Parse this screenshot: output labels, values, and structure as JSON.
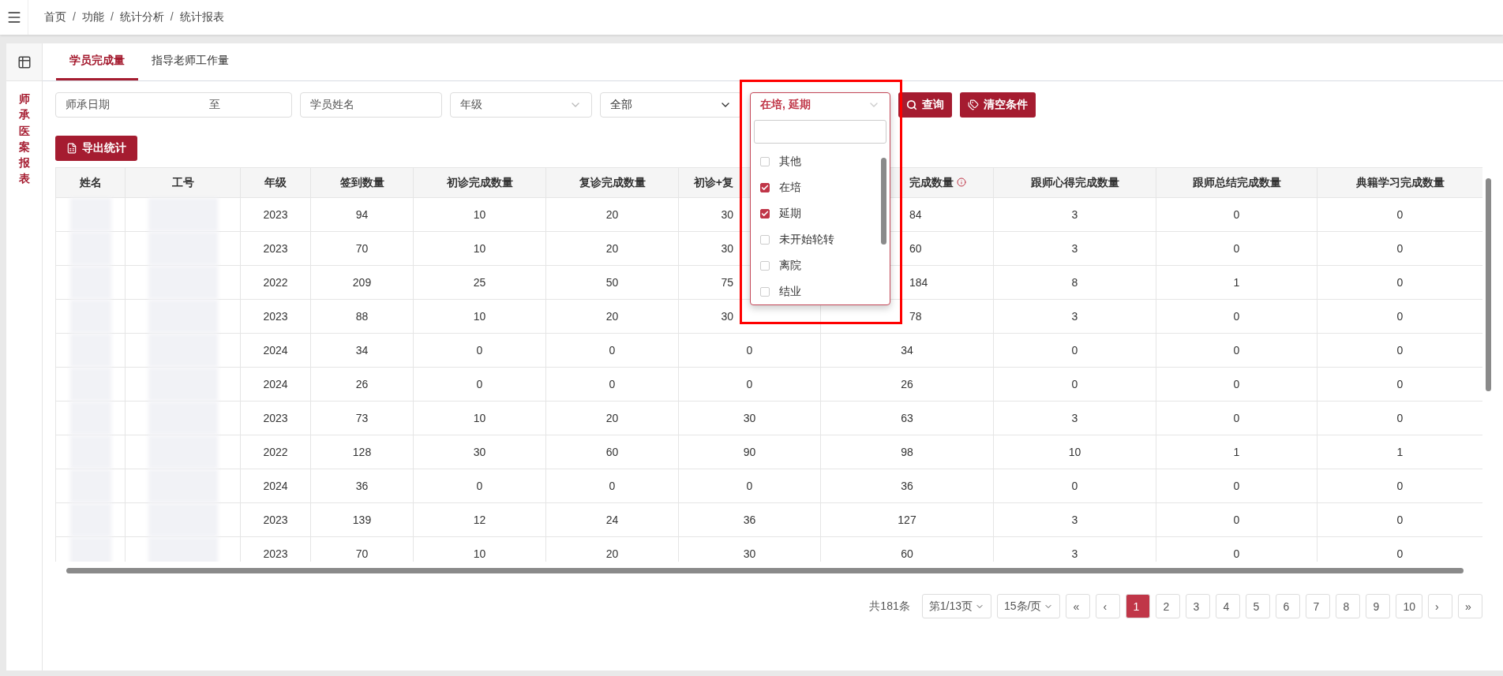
{
  "breadcrumb": {
    "separator": "/",
    "items": [
      "首页",
      "功能",
      "统计分析",
      "统计报表"
    ]
  },
  "side_label": "师承医案报表",
  "tabs": [
    {
      "label": "学员完成量",
      "selected": true
    },
    {
      "label": "指导老师工作量",
      "selected": false
    }
  ],
  "filters": {
    "date_range": {
      "placeholder": "师承日期",
      "separator": "至"
    },
    "name_field": {
      "placeholder": "学员姓名"
    },
    "grade_select": {
      "placeholder": "年级"
    },
    "type_select": {
      "value": "全部"
    },
    "status_select": {
      "value": "在培, 延期",
      "expanded": true,
      "options": [
        {
          "label": "其他",
          "checked": false
        },
        {
          "label": "在培",
          "checked": true
        },
        {
          "label": "延期",
          "checked": true
        },
        {
          "label": "未开始轮转",
          "checked": false
        },
        {
          "label": "离院",
          "checked": false
        },
        {
          "label": "结业",
          "checked": false
        }
      ]
    },
    "query_button": "查询",
    "clear_button": "清空条件"
  },
  "export_button": "导出统计",
  "table": {
    "columns": [
      "姓名",
      "工号",
      "年级",
      "签到数量",
      "初诊完成数量",
      "复诊完成数量",
      "初诊+复",
      "完成数量",
      "跟师心得完成数量",
      "跟师总结完成数量",
      "典籍学习完成数量"
    ],
    "rows": [
      {
        "cells": [
          "",
          "",
          "2023",
          "94",
          "10",
          "20",
          "30",
          "84",
          "3",
          "0",
          "0"
        ]
      },
      {
        "cells": [
          "",
          "",
          "2023",
          "70",
          "10",
          "20",
          "30",
          "60",
          "3",
          "0",
          "0"
        ]
      },
      {
        "cells": [
          "",
          "",
          "2022",
          "209",
          "25",
          "50",
          "75",
          "184",
          "8",
          "1",
          "0"
        ]
      },
      {
        "cells": [
          "",
          "",
          "2023",
          "88",
          "10",
          "20",
          "30",
          "78",
          "3",
          "0",
          "0"
        ]
      },
      {
        "cells": [
          "",
          "",
          "2024",
          "34",
          "0",
          "0",
          "0",
          "34",
          "0",
          "0",
          "0"
        ]
      },
      {
        "cells": [
          "",
          "",
          "2024",
          "26",
          "0",
          "0",
          "0",
          "26",
          "0",
          "0",
          "0"
        ]
      },
      {
        "cells": [
          "",
          "",
          "2023",
          "73",
          "10",
          "20",
          "30",
          "63",
          "3",
          "0",
          "0"
        ]
      },
      {
        "cells": [
          "",
          "",
          "2022",
          "128",
          "30",
          "60",
          "90",
          "98",
          "10",
          "1",
          "1"
        ]
      },
      {
        "cells": [
          "",
          "",
          "2024",
          "36",
          "0",
          "0",
          "0",
          "36",
          "0",
          "0",
          "0"
        ]
      },
      {
        "cells": [
          "",
          "",
          "2023",
          "139",
          "12",
          "24",
          "36",
          "127",
          "3",
          "0",
          "0"
        ]
      },
      {
        "cells": [
          "",
          "",
          "2023",
          "70",
          "10",
          "20",
          "30",
          "60",
          "3",
          "0",
          "0"
        ]
      }
    ]
  },
  "pagination": {
    "total": "共181条",
    "page_select": "第1/13页",
    "size_select": "15条/页",
    "first": "«",
    "prev": "‹",
    "next": "›",
    "last": "»",
    "pages": [
      {
        "label": "1",
        "selected": true
      },
      {
        "label": "2",
        "selected": false
      },
      {
        "label": "3",
        "selected": false
      },
      {
        "label": "4",
        "selected": false
      },
      {
        "label": "5",
        "selected": false
      },
      {
        "label": "6",
        "selected": false
      },
      {
        "label": "7",
        "selected": false
      },
      {
        "label": "8",
        "selected": false
      },
      {
        "label": "9",
        "selected": false
      },
      {
        "label": "10",
        "selected": false
      }
    ]
  }
}
